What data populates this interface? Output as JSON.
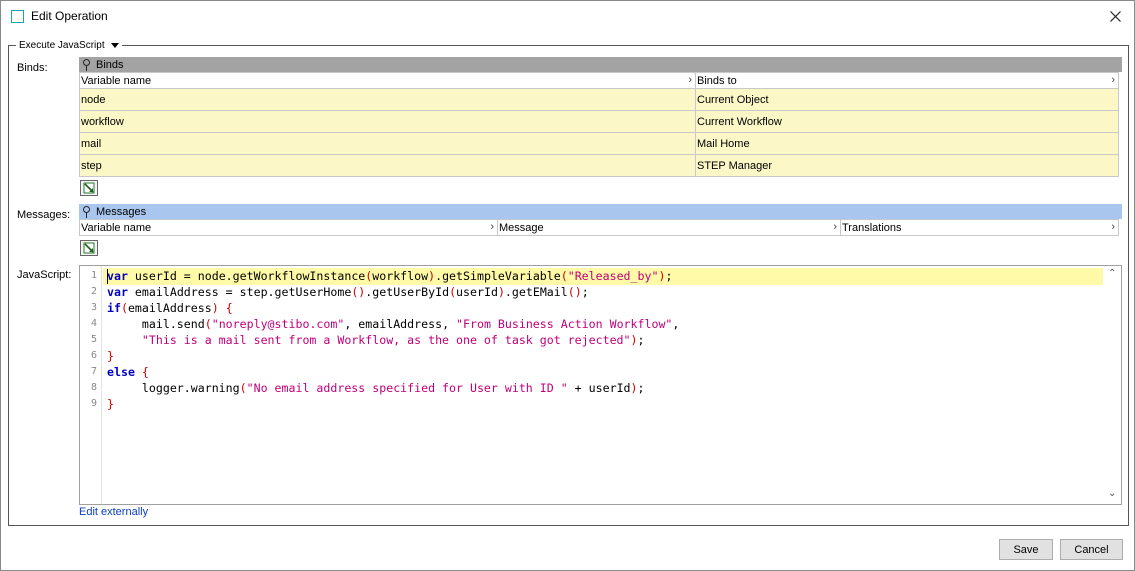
{
  "window": {
    "title": "Edit Operation"
  },
  "group": {
    "legend": "Execute JavaScript"
  },
  "binds": {
    "label": "Binds:",
    "header": "Binds",
    "columns": [
      "Variable name",
      "Binds to"
    ],
    "rows": [
      {
        "variable": "node",
        "binds_to": "Current Object"
      },
      {
        "variable": "workflow",
        "binds_to": "Current Workflow"
      },
      {
        "variable": "mail",
        "binds_to": "Mail Home"
      },
      {
        "variable": "step",
        "binds_to": "STEP Manager"
      }
    ]
  },
  "messages": {
    "label": "Messages:",
    "header": "Messages",
    "columns": [
      "Variable name",
      "Message",
      "Translations"
    ]
  },
  "javascript": {
    "label": "JavaScript:",
    "line_numbers": [
      "1",
      "2",
      "3",
      "4",
      "5",
      "6",
      "7",
      "8",
      "9"
    ],
    "edit_externally": "Edit externally"
  },
  "footer": {
    "save": "Save",
    "cancel": "Cancel"
  },
  "colors": {
    "bind_row_bg": "#fbf7c6",
    "binds_header_bg": "#a3a3a3",
    "messages_header_bg": "#a9c6ee",
    "keyword": "#0000c0",
    "string": "#c0007a",
    "current_line": "#fffaa8"
  }
}
